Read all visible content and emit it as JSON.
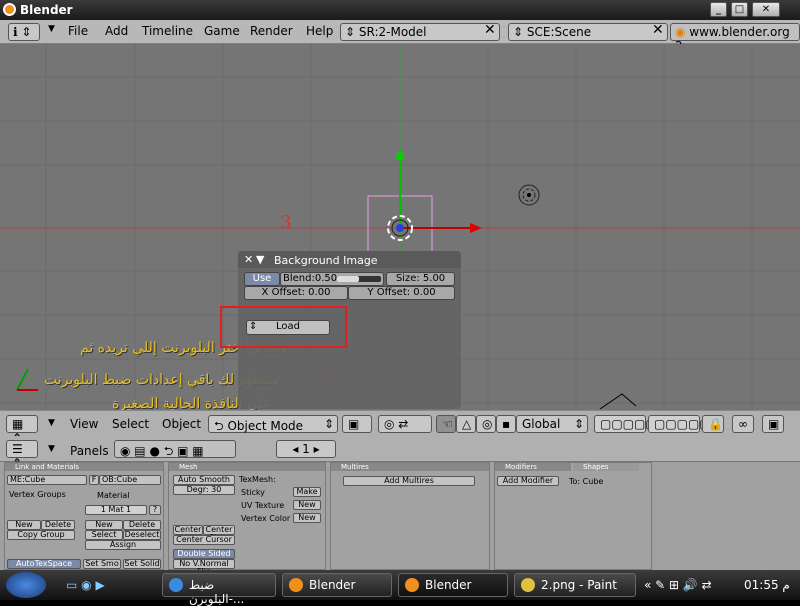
{
  "window": {
    "title": "Blender"
  },
  "menubar": {
    "items": [
      "File",
      "Add",
      "Timeline",
      "Game",
      "Render",
      "Help"
    ],
    "screen": "SR:2-Model",
    "scene": "SCE:Scene",
    "link": "www.blender.org 2"
  },
  "viewport": {
    "label_3": "3",
    "label_4": "4",
    "annotation": [
      "وبعدين أختر البلوبرنت إللي تريده ثم",
      "ستظهر لك باقي إعدادات ضبط البلوبرنت",
      "على النافذة الحالية الصغيرة"
    ]
  },
  "bgpanel": {
    "title": "Background Image",
    "use": "Use",
    "blend": "Blend:0.50",
    "size": "Size: 5.00",
    "xoffset": "X Offset: 0.00",
    "yoffset": "Y Offset: 0.00",
    "load": "Load"
  },
  "header3d": {
    "view": "View",
    "select": "Select",
    "object": "Object",
    "mode": "Object Mode",
    "orientation": "Global"
  },
  "buttons": {
    "panels": "Panels",
    "frame": "1",
    "link": {
      "title": "Link and Materials",
      "me": "ME:Cube",
      "f": "F",
      "ob": "OB:Cube",
      "vgroups": "Vertex Groups",
      "material": "Material",
      "mat": "1 Mat 1",
      "q": "?",
      "new": "New",
      "delete": "Delete",
      "copy_group": "Copy Group",
      "new2": "New",
      "delete2": "Delete",
      "select": "Select",
      "deselect": "Deselect",
      "assign": "Assign",
      "autotex": "AutoTexSpace",
      "setsmo": "Set Smo",
      "setsolid": "Set Solid"
    },
    "mesh": {
      "title": "Mesh",
      "autosmooth": "Auto Smooth",
      "degr": "Degr: 30",
      "texmesh": "TexMesh:",
      "sticky": "Sticky",
      "make": "Make",
      "uvtex": "UV Texture",
      "new1": "New",
      "vcol": "Vertex Color",
      "new2": "New",
      "center": "Center",
      "centernew": "Center New",
      "centercursor": "Center Cursor",
      "doublesided": "Double Sided",
      "nonormal": "No V.Normal Flip"
    },
    "multires": {
      "title": "Multires",
      "add": "Add Multires"
    },
    "modifiers": {
      "tab1": "Modifiers",
      "tab2": "Shapes",
      "add": "Add Modifier",
      "to": "To: Cube"
    }
  },
  "taskbar": {
    "tasks": [
      "ضبط البلوبرن-...",
      "Blender",
      "Blender",
      "2.png - Paint"
    ],
    "time": "01:55 م"
  }
}
